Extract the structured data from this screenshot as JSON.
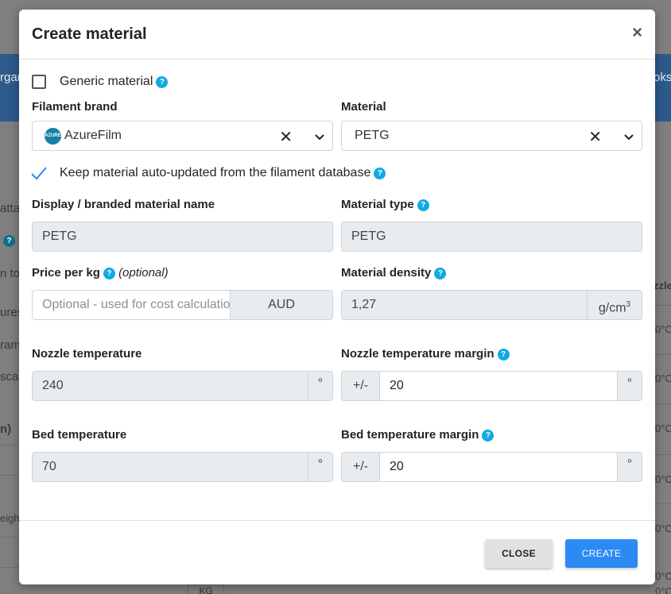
{
  "background": {
    "fragments": [
      "rgan",
      "oks",
      "atta",
      "n to",
      "ures",
      "ram",
      "sca",
      "n)",
      "zzle",
      "eigh",
      "0°C",
      "0°C",
      "0°C",
      "0°C",
      "0°C",
      "0°C",
      "0°C",
      "KG"
    ]
  },
  "modal": {
    "title": "Create material",
    "close_symbol": "×"
  },
  "form": {
    "generic_material": {
      "label": "Generic material",
      "checked": false
    },
    "filament_brand": {
      "label": "Filament brand",
      "value": "AzureFilm",
      "logo_text": "AZURE FILM"
    },
    "material": {
      "label": "Material",
      "value": "PETG"
    },
    "auto_update": {
      "label": "Keep material auto-updated from the filament database",
      "checked": true
    },
    "display_name": {
      "label": "Display / branded material name",
      "value": "PETG"
    },
    "material_type": {
      "label": "Material type",
      "value": "PETG"
    },
    "price_per_kg": {
      "label": "Price per kg",
      "optional": "(optional)",
      "placeholder": "Optional - used for cost calculations",
      "currency": "AUD"
    },
    "material_density": {
      "label": "Material density",
      "value": "1,27",
      "unit": "g/cm",
      "unit_sup": "3"
    },
    "nozzle_temperature": {
      "label": "Nozzle temperature",
      "value": "240",
      "unit": "°"
    },
    "nozzle_temperature_margin": {
      "label": "Nozzle temperature margin",
      "prefix": "+/-",
      "value": "20",
      "unit": "°"
    },
    "bed_temperature": {
      "label": "Bed temperature",
      "value": "70",
      "unit": "°"
    },
    "bed_temperature_margin": {
      "label": "Bed temperature margin",
      "prefix": "+/-",
      "value": "20",
      "unit": "°"
    }
  },
  "footer": {
    "close_label": "CLOSE",
    "create_label": "CREATE"
  },
  "icons": {
    "help": "?",
    "clear": "✕"
  },
  "colors": {
    "help_icon": "#12a9e3",
    "primary_button": "#2b8af4",
    "secondary_button": "#e2e2e2",
    "check_mark": "#2b8af4"
  }
}
